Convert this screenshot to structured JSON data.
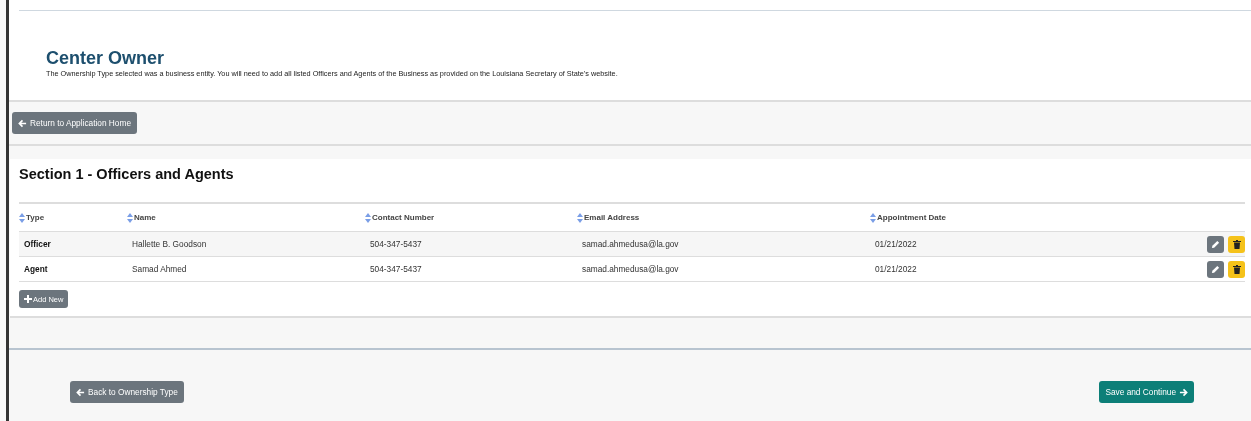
{
  "header": {
    "title": "Center Owner",
    "description": "The Ownership Type selected was a business entity. You will need to add all listed Officers and Agents of the Business as provided on the Louisiana Secretary of State's website."
  },
  "return_button": {
    "label": "Return to Application Home"
  },
  "section": {
    "title": "Section 1 - Officers and Agents",
    "table": {
      "columns": [
        "Type",
        "Name",
        "Contact Number",
        "Email Address",
        "Appointment Date"
      ],
      "rows": [
        {
          "type": "Officer",
          "name": "Hallette B. Goodson",
          "contact": "504-347-5437",
          "email": "samad.ahmedusa@la.gov",
          "date": "01/21/2022"
        },
        {
          "type": "Agent",
          "name": "Samad Ahmed",
          "contact": "504-347-5437",
          "email": "samad.ahmedusa@la.gov",
          "date": "01/21/2022"
        }
      ]
    },
    "add_button": {
      "label": "Add New"
    }
  },
  "footer": {
    "back_button": {
      "label": "Back to Ownership Type"
    },
    "save_button": {
      "label": "Save and Continue"
    }
  }
}
